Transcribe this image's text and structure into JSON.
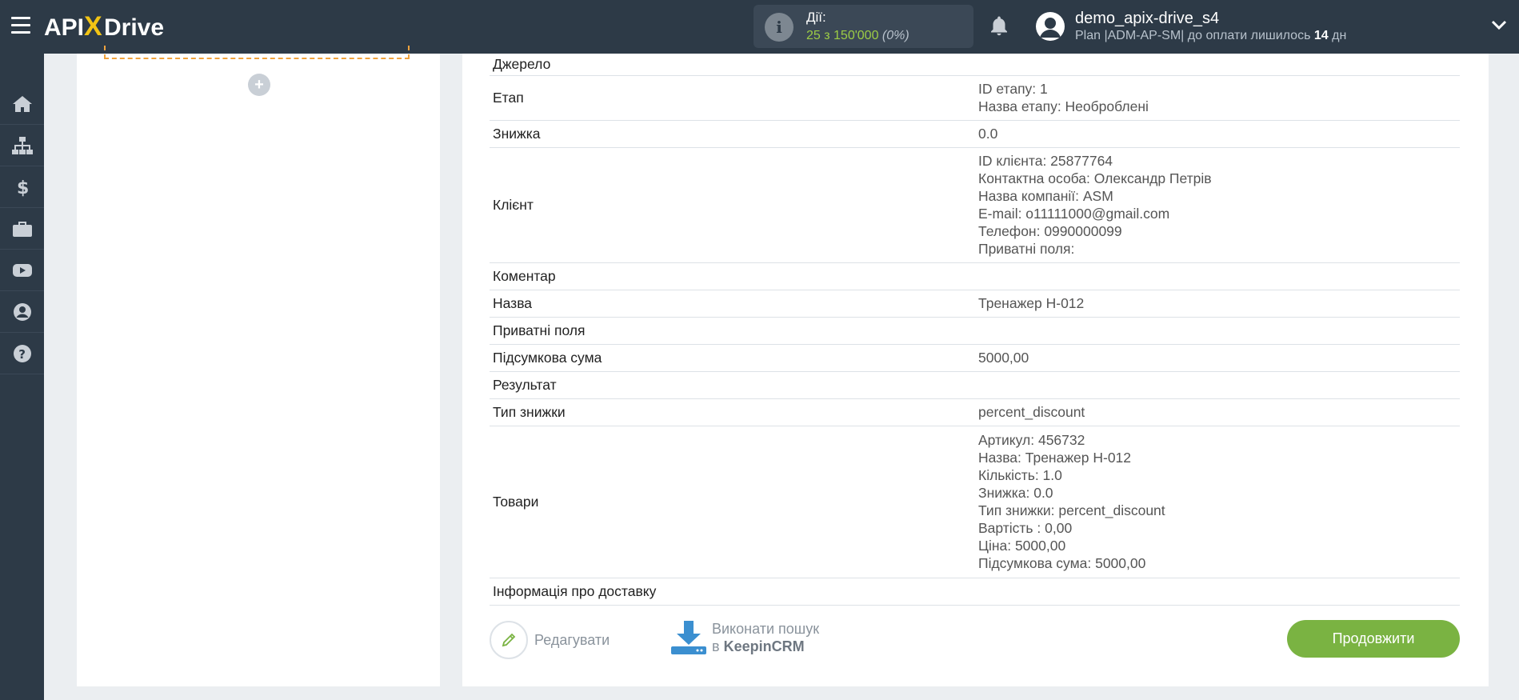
{
  "app": {
    "logo_text": "APIXDrive"
  },
  "header": {
    "actions_label": "Дії:",
    "actions_value": "25 з 150'000",
    "actions_percent": "(0%)",
    "user_name": "demo_apix-drive_s4",
    "plan_prefix": "Plan |ADM-AP-SM| до оплати лишилось ",
    "plan_days": "14",
    "plan_suffix": " дн"
  },
  "sidebar": {
    "items": [
      {
        "icon": "home-icon"
      },
      {
        "icon": "sitemap-icon"
      },
      {
        "icon": "dollar-icon"
      },
      {
        "icon": "briefcase-icon"
      },
      {
        "icon": "youtube-icon"
      },
      {
        "icon": "user-icon"
      },
      {
        "icon": "help-icon"
      }
    ]
  },
  "fields": [
    {
      "key": "Джерело",
      "value": []
    },
    {
      "key": "Етап",
      "value": [
        "ID етапу: 1",
        "Назва етапу: Необроблені"
      ]
    },
    {
      "key": "Знижка",
      "value": [
        "0.0"
      ]
    },
    {
      "key": "Клієнт",
      "value": [
        "ID клієнта: 25877764",
        "Контактна особа: Олександр Петрів",
        "Назва компанії: ASM",
        "E-mail: o11111000@gmail.com",
        "Телефон: 0990000099",
        "Приватні поля:"
      ]
    },
    {
      "key": "Коментар",
      "value": []
    },
    {
      "key": "Назва",
      "value": [
        "Тренажер H-012"
      ]
    },
    {
      "key": "Приватні поля",
      "value": []
    },
    {
      "key": "Підсумкова сума",
      "value": [
        "5000,00"
      ]
    },
    {
      "key": "Результат",
      "value": []
    },
    {
      "key": "Тип знижки",
      "value": [
        "percent_discount"
      ]
    },
    {
      "key": "Товари",
      "value": [
        "Артикул: 456732",
        "Назва: Тренажер H-012",
        "Кількість: 1.0",
        "Знижка: 0.0",
        "Тип знижки: percent_discount",
        "Вартість : 0,00",
        "Ціна: 5000,00",
        "Підсумкова сума: 5000,00"
      ]
    },
    {
      "key": "Інформація про доставку",
      "value": []
    }
  ],
  "buttons": {
    "edit": "Редагувати",
    "search_line1": "Виконати пошук",
    "search_prefix": "в ",
    "search_service": "KeepinCRM",
    "continue": "Продовжити"
  },
  "colors": {
    "header_bg": "#2d3a47",
    "accent_green": "#7ab342",
    "accent_orange": "#f0a33e",
    "search_icon_blue": "#3b8fd0"
  }
}
